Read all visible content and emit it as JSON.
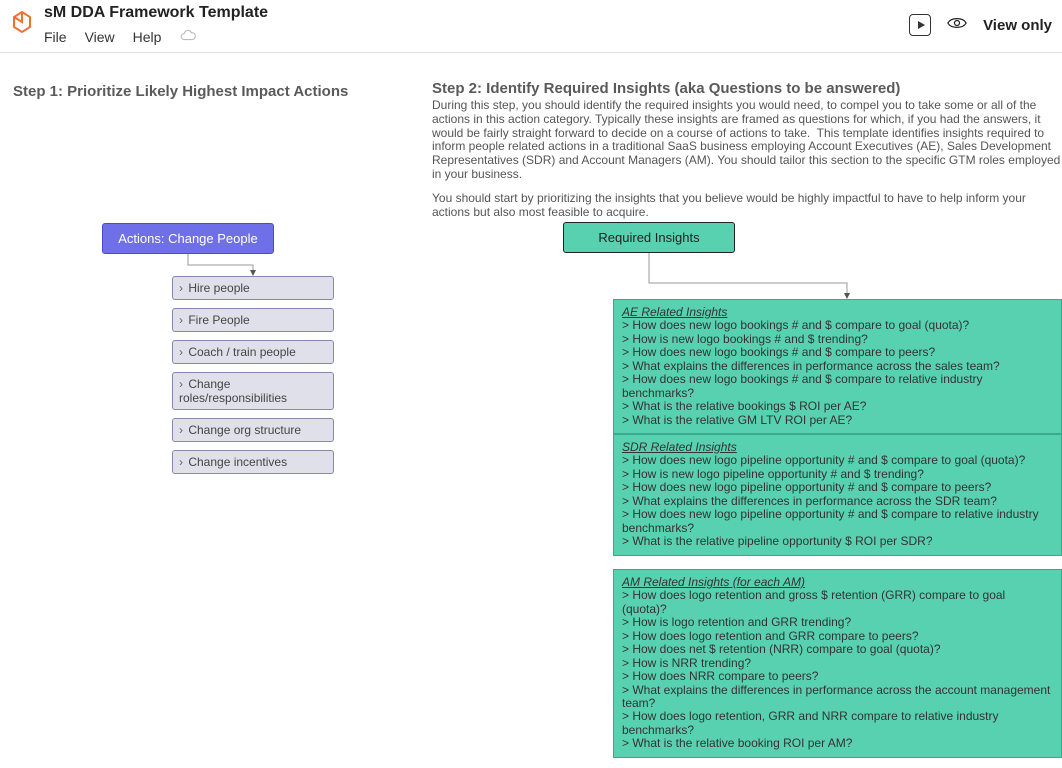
{
  "doc": {
    "title": "sM DDA Framework Template",
    "menus": {
      "file": "File",
      "view": "View",
      "help": "Help"
    },
    "view_only": "View only"
  },
  "step1": {
    "title": "Step 1: Prioritize Likely Highest Impact Actions"
  },
  "step2": {
    "title": "Step 2: Identify Required Insights (aka Questions to be answered)",
    "para1": "During this step, you should identify the required insights you would need, to compel you to take some or all of the actions in this action category. Typically these insights are framed as questions for which, if you had the answers, it would be fairly straight forward to decide on a course of actions to take.  This template identifies insights required to inform people related actions in a traditional SaaS business employing Account Executives (AE), Sales Development Representatives (SDR) and Account Managers (AM). You should tailor this section to the specific GTM roles employed in your business.",
    "para2": "You should start by prioritizing the insights that you believe would be highly impactful to have to help inform your actions but also most feasible to acquire."
  },
  "actions": {
    "box_label": "Actions: Change People",
    "items": [
      "Hire people",
      "Fire People",
      "Coach / train people",
      "Change roles/responsibilities",
      "Change org structure",
      "Change incentives"
    ]
  },
  "insights": {
    "box_label": "Required Insights",
    "blocks": [
      {
        "title": "AE Related Insights",
        "lines": [
          "> How does new logo bookings # and $ compare to goal (quota)?",
          "> How is new logo bookings # and $ trending?",
          "> How does new logo bookings # and $ compare to peers?",
          "> What explains the differences in performance across the sales team?",
          "> How does new logo bookings # and $ compare to relative industry benchmarks?",
          "> What is the relative bookings $ ROI per AE?",
          "> What is the relative GM LTV ROI per AE?"
        ]
      },
      {
        "title": "SDR Related Insights",
        "lines": [
          "> How does new logo pipeline opportunity # and $ compare to goal (quota)?",
          "> How is new logo pipeline opportunity # and $ trending?",
          "> How does new logo pipeline opportunity # and $ compare to peers?",
          "> What explains the differences in performance across the SDR team?",
          "> How does new logo pipeline opportunity # and $ compare to relative industry benchmarks?",
          "> What is the relative pipeline opportunity $ ROI per SDR?"
        ]
      },
      {
        "title": "AM Related Insights (for each AM)",
        "lines": [
          "> How does logo retention and gross $ retention (GRR) compare to goal (quota)?",
          "> How is logo retention and GRR trending?",
          "> How does logo retention and GRR compare to peers?",
          "> How does net $ retention (NRR) compare to goal (quota)?",
          "> How is NRR trending?",
          "> How does NRR compare to peers?",
          "> What explains the differences in performance across the account management team?",
          "> How does logo retention, GRR and NRR compare to relative industry benchmarks?",
          "> What is the relative booking ROI per AM?"
        ]
      }
    ]
  }
}
